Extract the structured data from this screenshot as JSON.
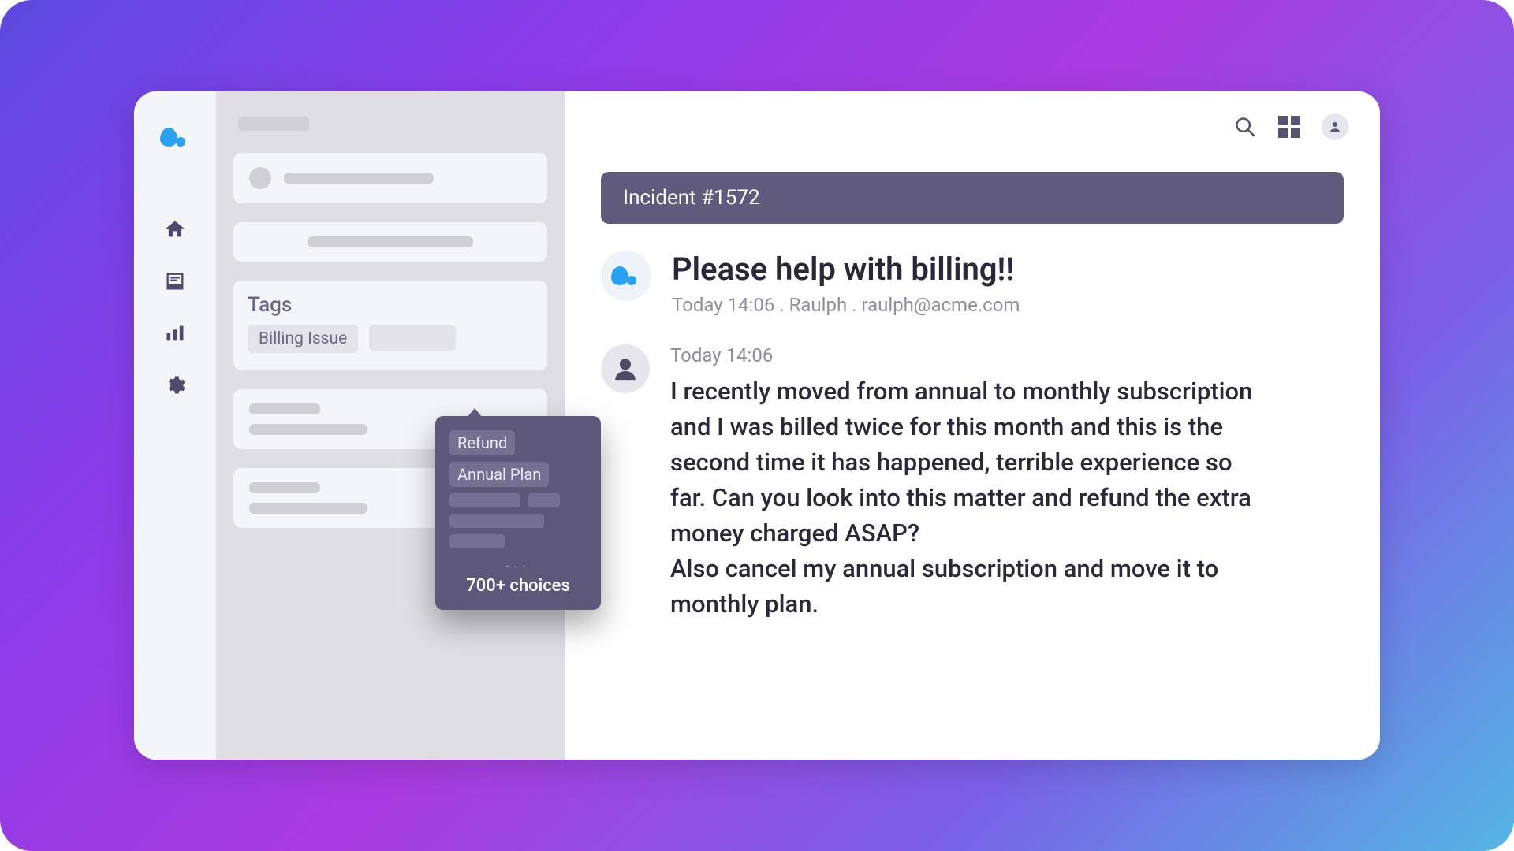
{
  "sidebar": {
    "tags": {
      "title": "Tags",
      "applied": [
        "Billing Issue"
      ]
    }
  },
  "tag_picker": {
    "options": [
      "Refund",
      "Annual Plan"
    ],
    "ellipsis": "...",
    "footer": "700+ choices"
  },
  "header": {
    "incident_label": "Incident #1572"
  },
  "ticket": {
    "title": "Please help with billing!!",
    "meta": "Today 14:06 . Raulph . raulph@acme.com"
  },
  "message": {
    "time": "Today 14:06",
    "body": "I recently moved from annual to monthly subscription and I was billed twice for this month and this is the second time it has happened, terrible experience so far. Can you look into this matter and refund the extra money charged ASAP?\nAlso cancel my annual subscription and move it to monthly plan."
  }
}
